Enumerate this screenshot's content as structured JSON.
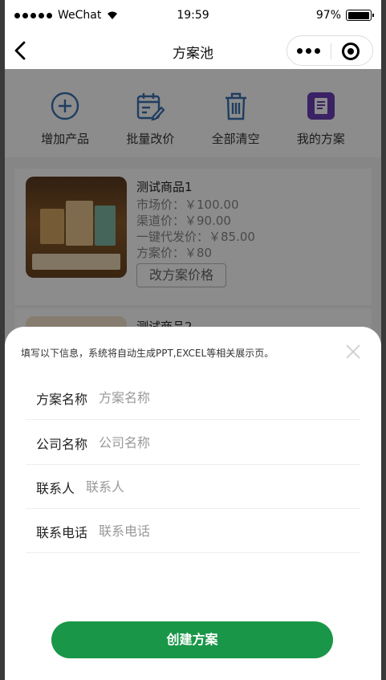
{
  "status_bar": {
    "carrier": "WeChat",
    "time": "19:59",
    "battery": "97%",
    "battery_level": 0.97
  },
  "nav": {
    "title": "方案池"
  },
  "actions": [
    {
      "label": "增加产品",
      "icon": "add-circle-icon"
    },
    {
      "label": "批量改价",
      "icon": "calendar-edit-icon"
    },
    {
      "label": "全部清空",
      "icon": "trash-icon"
    },
    {
      "label": "我的方案",
      "icon": "document-icon"
    }
  ],
  "products": [
    {
      "name": "测试商品1",
      "market_price": "市场价：￥100.00",
      "channel_price": "渠道价：￥90.00",
      "dropship_price": "一键代发价：￥85.00",
      "plan_price": "方案价：￥80",
      "edit_button": "改方案价格"
    },
    {
      "name": "测试商品2"
    }
  ],
  "sheet": {
    "hint": "填写以下信息，系统将自动生成PPT,EXCEL等相关展示页。",
    "fields": [
      {
        "label": "方案名称",
        "placeholder": "方案名称",
        "value": ""
      },
      {
        "label": "公司名称",
        "placeholder": "公司名称",
        "value": ""
      },
      {
        "label": "联系人",
        "placeholder": "联系人",
        "value": ""
      },
      {
        "label": "联系电话",
        "placeholder": "联系电话",
        "value": ""
      }
    ],
    "submit_label": "创建方案"
  },
  "colors": {
    "accent_green": "#1a9648",
    "icon_blue": "#3a6fb0",
    "icon_purple": "#6a3fb8"
  }
}
